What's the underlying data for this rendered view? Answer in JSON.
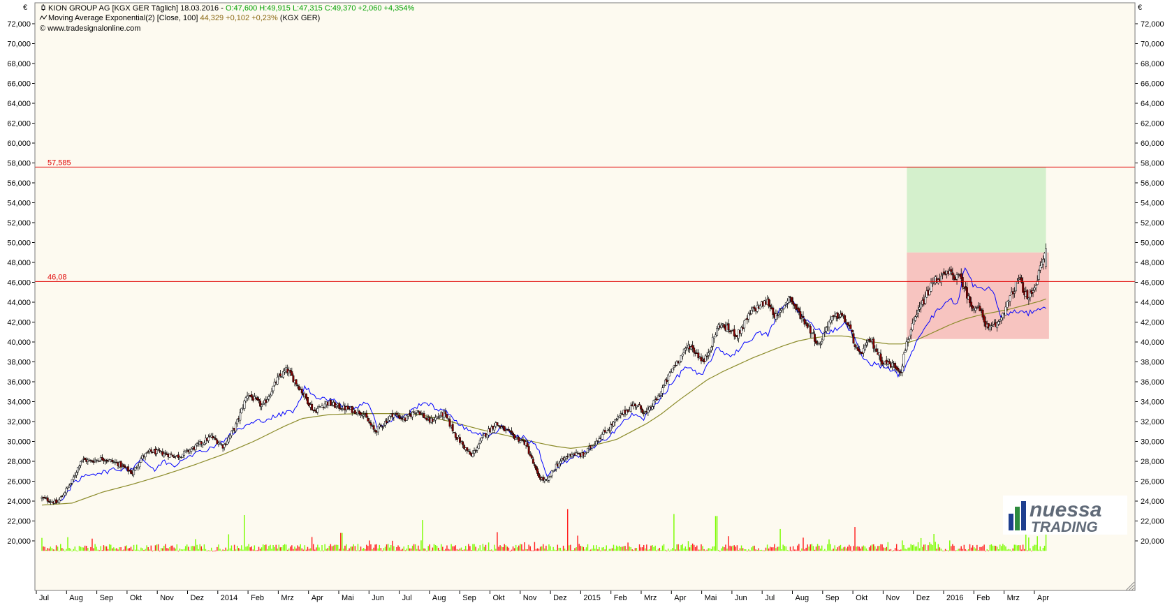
{
  "header": {
    "currency_symbol": "€",
    "line1_prefix": "KION GROUP AG [KGX GER  Täglich] 18.03.2016 - ",
    "line1_quote": "O:47,600 H:49,915 L:47,315 C:49,370 +2,060 +4,354%",
    "line2_prefix": "Moving Average Exponential(2) [Close, 100] ",
    "line2_value": "44,329 +0,102 +0,23%",
    "line2_suffix": " (KGX GER)",
    "line3": "© www.tradesignalonline.com"
  },
  "logo": {
    "line1": "nuessa",
    "line2": "TRADING"
  },
  "colors": {
    "background": "#fdfaf0",
    "candle_up": "#ffffff",
    "candle_down": "#8b0000",
    "ma_line": "#8b8b2a",
    "band_line": "#0000ff",
    "level_line": "#e00000",
    "volume_up": "#7cfc00",
    "volume_down": "#ff2020",
    "zone_green": "#d4f0cc",
    "zone_red": "#f7c4c0",
    "quote_up": "#00a000",
    "ma_value": "#8b6914"
  },
  "chart_data": {
    "type": "candlestick",
    "title": "KION GROUP AG [KGX GER  Täglich] 18.03.2016",
    "ylabel": "€",
    "ylim": [
      19000,
      73000
    ],
    "y_ticks": [
      "20,000",
      "22,000",
      "24,000",
      "26,000",
      "28,000",
      "30,000",
      "32,000",
      "34,000",
      "36,000",
      "38,000",
      "40,000",
      "42,000",
      "44,000",
      "46,000",
      "48,000",
      "50,000",
      "52,000",
      "54,000",
      "56,000",
      "58,000",
      "60,000",
      "62,000",
      "64,000",
      "66,000",
      "68,000",
      "70,000",
      "72,000"
    ],
    "x_labels": [
      "Jul",
      "Aug",
      "Sep",
      "Okt",
      "Nov",
      "Dez",
      "2014",
      "Feb",
      "Mrz",
      "Apr",
      "Mai",
      "Jun",
      "Jul",
      "Aug",
      "Sep",
      "Okt",
      "Nov",
      "Dez",
      "2015",
      "Feb",
      "Mrz",
      "Apr",
      "Mai",
      "Jun",
      "Jul",
      "Aug",
      "Sep",
      "Okt",
      "Nov",
      "Dez",
      "2016",
      "Feb",
      "Mrz",
      "Apr"
    ],
    "horizontal_levels": [
      {
        "label": "57,585",
        "value": 57585
      },
      {
        "label": "46,08",
        "value": 46080
      }
    ],
    "zones": [
      {
        "name": "target-zone-green",
        "color": "green",
        "x_from": 28.6,
        "x_to": 33.2,
        "y_from": 49000,
        "y_to": 57585
      },
      {
        "name": "stop-zone-red",
        "color": "red",
        "x_from": 28.6,
        "x_to": 33.3,
        "y_from": 40300,
        "y_to": 49000
      }
    ],
    "close_anchors": [
      [
        0.0,
        24300
      ],
      [
        0.5,
        23800
      ],
      [
        1.0,
        26000
      ],
      [
        1.3,
        28200
      ],
      [
        1.6,
        28000
      ],
      [
        2.0,
        28300
      ],
      [
        2.5,
        27800
      ],
      [
        3.0,
        26800
      ],
      [
        3.3,
        28400
      ],
      [
        3.6,
        29000
      ],
      [
        4.0,
        28800
      ],
      [
        4.5,
        28500
      ],
      [
        5.0,
        29300
      ],
      [
        5.6,
        30500
      ],
      [
        6.0,
        29500
      ],
      [
        6.4,
        31500
      ],
      [
        6.8,
        34800
      ],
      [
        7.3,
        33500
      ],
      [
        7.8,
        36300
      ],
      [
        8.1,
        37200
      ],
      [
        8.5,
        35500
      ],
      [
        9.0,
        33000
      ],
      [
        9.4,
        33900
      ],
      [
        9.8,
        33500
      ],
      [
        10.2,
        33200
      ],
      [
        10.6,
        32900
      ],
      [
        11.0,
        31000
      ],
      [
        11.3,
        31800
      ],
      [
        11.6,
        32800
      ],
      [
        12.0,
        32200
      ],
      [
        12.4,
        33200
      ],
      [
        12.8,
        32000
      ],
      [
        13.3,
        32800
      ],
      [
        13.7,
        30500
      ],
      [
        14.2,
        28500
      ],
      [
        14.6,
        30500
      ],
      [
        15.0,
        31800
      ],
      [
        15.5,
        30700
      ],
      [
        16.0,
        29800
      ],
      [
        16.4,
        26500
      ],
      [
        16.7,
        25900
      ],
      [
        17.0,
        27600
      ],
      [
        17.5,
        28800
      ],
      [
        17.9,
        28600
      ],
      [
        18.3,
        30000
      ],
      [
        18.7,
        31200
      ],
      [
        19.2,
        32800
      ],
      [
        19.6,
        33800
      ],
      [
        20.0,
        32800
      ],
      [
        20.4,
        34600
      ],
      [
        20.9,
        37600
      ],
      [
        21.4,
        39700
      ],
      [
        21.9,
        38000
      ],
      [
        22.4,
        41800
      ],
      [
        23.0,
        40700
      ],
      [
        23.5,
        43200
      ],
      [
        24.0,
        44100
      ],
      [
        24.3,
        42300
      ],
      [
        24.7,
        44600
      ],
      [
        25.0,
        43000
      ],
      [
        25.3,
        41800
      ],
      [
        25.7,
        39600
      ],
      [
        26.0,
        42000
      ],
      [
        26.4,
        42800
      ],
      [
        26.7,
        41500
      ],
      [
        27.0,
        38600
      ],
      [
        27.4,
        40200
      ],
      [
        27.8,
        38000
      ],
      [
        28.2,
        37600
      ],
      [
        28.4,
        37100
      ],
      [
        28.6,
        40100
      ],
      [
        29.0,
        43200
      ],
      [
        29.5,
        46200
      ],
      [
        30.0,
        46900
      ],
      [
        30.4,
        46300
      ],
      [
        30.7,
        43800
      ],
      [
        31.0,
        43300
      ],
      [
        31.3,
        41200
      ],
      [
        31.6,
        41800
      ],
      [
        32.0,
        44300
      ],
      [
        32.3,
        46400
      ],
      [
        32.6,
        44200
      ],
      [
        32.9,
        46200
      ],
      [
        33.2,
        49370
      ]
    ],
    "ma100_anchors": [
      [
        0.0,
        23600
      ],
      [
        1.0,
        23800
      ],
      [
        2.0,
        24900
      ],
      [
        3.0,
        25700
      ],
      [
        4.0,
        26600
      ],
      [
        5.0,
        27600
      ],
      [
        6.0,
        28700
      ],
      [
        7.0,
        30000
      ],
      [
        8.0,
        31500
      ],
      [
        8.6,
        32300
      ],
      [
        9.5,
        32700
      ],
      [
        10.5,
        32800
      ],
      [
        11.5,
        32800
      ],
      [
        12.5,
        32700
      ],
      [
        13.5,
        32000
      ],
      [
        14.5,
        31200
      ],
      [
        15.5,
        30500
      ],
      [
        16.5,
        29800
      ],
      [
        17.0,
        29500
      ],
      [
        17.5,
        29300
      ],
      [
        18.0,
        29500
      ],
      [
        18.5,
        29800
      ],
      [
        19.0,
        30200
      ],
      [
        19.5,
        31000
      ],
      [
        20.0,
        31800
      ],
      [
        20.5,
        32800
      ],
      [
        21.0,
        34000
      ],
      [
        21.5,
        35100
      ],
      [
        22.0,
        36200
      ],
      [
        22.5,
        37000
      ],
      [
        23.0,
        37700
      ],
      [
        23.5,
        38400
      ],
      [
        24.0,
        39000
      ],
      [
        24.5,
        39600
      ],
      [
        25.0,
        40100
      ],
      [
        25.5,
        40400
      ],
      [
        26.0,
        40600
      ],
      [
        26.5,
        40600
      ],
      [
        27.0,
        40400
      ],
      [
        27.5,
        40000
      ],
      [
        28.0,
        39800
      ],
      [
        28.5,
        39800
      ],
      [
        29.0,
        40300
      ],
      [
        29.5,
        41000
      ],
      [
        30.0,
        41700
      ],
      [
        30.5,
        42300
      ],
      [
        31.0,
        42700
      ],
      [
        31.5,
        43000
      ],
      [
        32.0,
        43300
      ],
      [
        32.5,
        43700
      ],
      [
        33.0,
        44100
      ],
      [
        33.2,
        44329
      ]
    ],
    "band_anchors": [
      [
        0.6,
        24000
      ],
      [
        1.0,
        25600
      ],
      [
        1.5,
        26700
      ],
      [
        2.0,
        26900
      ],
      [
        2.5,
        27200
      ],
      [
        3.0,
        27300
      ],
      [
        3.3,
        28400
      ],
      [
        3.7,
        27000
      ],
      [
        4.0,
        28000
      ],
      [
        4.4,
        27600
      ],
      [
        4.8,
        28600
      ],
      [
        5.2,
        28900
      ],
      [
        5.6,
        29400
      ],
      [
        6.0,
        30100
      ],
      [
        6.5,
        31200
      ],
      [
        7.0,
        31900
      ],
      [
        7.5,
        32300
      ],
      [
        8.0,
        32800
      ],
      [
        8.4,
        33200
      ],
      [
        8.7,
        35500
      ],
      [
        9.0,
        34600
      ],
      [
        9.4,
        34300
      ],
      [
        9.7,
        34000
      ],
      [
        10.0,
        33600
      ],
      [
        10.4,
        33400
      ],
      [
        10.8,
        34000
      ],
      [
        11.1,
        31400
      ],
      [
        11.4,
        31700
      ],
      [
        11.7,
        32500
      ],
      [
        12.0,
        32500
      ],
      [
        12.6,
        34000
      ],
      [
        13.0,
        33400
      ],
      [
        13.5,
        32700
      ],
      [
        14.0,
        31200
      ],
      [
        14.4,
        30900
      ],
      [
        14.8,
        30400
      ],
      [
        15.2,
        31600
      ],
      [
        15.6,
        30600
      ],
      [
        16.0,
        30300
      ],
      [
        16.4,
        29400
      ],
      [
        16.7,
        26500
      ],
      [
        17.0,
        27200
      ],
      [
        17.4,
        28100
      ],
      [
        17.8,
        28700
      ],
      [
        18.2,
        29200
      ],
      [
        18.6,
        30200
      ],
      [
        19.0,
        31300
      ],
      [
        19.5,
        32700
      ],
      [
        19.9,
        32300
      ],
      [
        20.3,
        33800
      ],
      [
        20.8,
        35700
      ],
      [
        21.3,
        37600
      ],
      [
        21.8,
        36500
      ],
      [
        22.3,
        39300
      ],
      [
        22.8,
        38600
      ],
      [
        23.3,
        40000
      ],
      [
        23.7,
        40900
      ],
      [
        24.0,
        40700
      ],
      [
        24.4,
        43200
      ],
      [
        24.8,
        44300
      ],
      [
        25.1,
        42600
      ],
      [
        25.5,
        41600
      ],
      [
        25.9,
        40900
      ],
      [
        26.2,
        41200
      ],
      [
        26.6,
        41900
      ],
      [
        26.9,
        40100
      ],
      [
        27.2,
        38100
      ],
      [
        27.6,
        37700
      ],
      [
        28.0,
        37400
      ],
      [
        28.3,
        36700
      ],
      [
        28.6,
        37600
      ],
      [
        28.9,
        40000
      ],
      [
        29.3,
        42100
      ],
      [
        29.7,
        43400
      ],
      [
        30.0,
        44300
      ],
      [
        30.3,
        43800
      ],
      [
        30.5,
        47600
      ],
      [
        30.8,
        45700
      ],
      [
        31.1,
        45200
      ],
      [
        31.4,
        45500
      ],
      [
        31.7,
        42600
      ],
      [
        32.0,
        42900
      ],
      [
        32.3,
        43100
      ],
      [
        32.6,
        42800
      ],
      [
        32.9,
        43400
      ],
      [
        33.2,
        43300
      ]
    ],
    "volume_events": [
      [
        0.0,
        20300
      ],
      [
        6.7,
        22600
      ],
      [
        9.9,
        20800
      ],
      [
        12.6,
        22100
      ],
      [
        17.4,
        23200
      ],
      [
        20.9,
        22700
      ],
      [
        22.3,
        22500
      ],
      [
        24.4,
        21200
      ],
      [
        26.9,
        21400
      ],
      [
        29.5,
        20700
      ],
      [
        33.2,
        22300
      ]
    ],
    "last_bar": {
      "open": 47600,
      "high": 49915,
      "low": 47315,
      "close": 49370
    }
  }
}
